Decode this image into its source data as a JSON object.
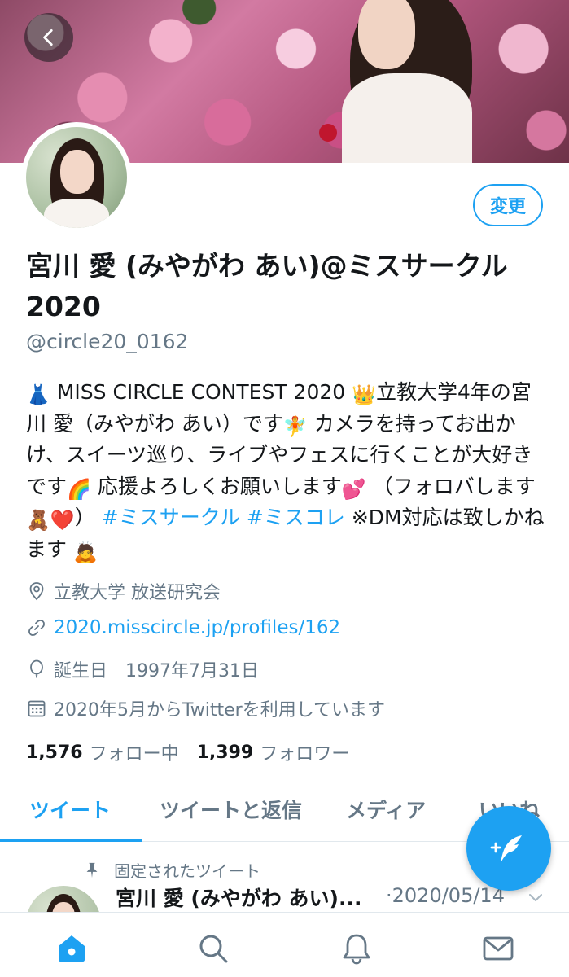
{
  "profile": {
    "edit_label": "変更",
    "display_name": "宮川 愛 (みやがわ あい)@ミスサークル2020",
    "handle": "@circle20_0162",
    "bio": {
      "part1": "MISS CIRCLE CONTEST 2020",
      "part2": "立教大学4年の宮川 愛（みやがわ あい）です",
      "part3": "カメラを持ってお出かけ、スイーツ巡り、ライブやフェスに行くことが大好きです",
      "part4": "応援よろしくお願いします",
      "part5": "（フォロバします",
      "part6": "）",
      "tag1": "#ミスサークル",
      "tag2": "#ミスコレ",
      "part7": "※DM対応は致しかねます"
    },
    "location": "立教大学 放送研究会",
    "website": "2020.misscircle.jp/profiles/162",
    "birthday_label": "誕生日",
    "birthday": "1997年7月31日",
    "joined": "2020年5月からTwitterを利用しています",
    "following_count": "1,576",
    "following_label": "フォロー中",
    "followers_count": "1,399",
    "followers_label": "フォロワー"
  },
  "tabs": [
    {
      "label": "ツイート",
      "active": true
    },
    {
      "label": "ツイートと返信",
      "active": false
    },
    {
      "label": "メディア",
      "active": false
    },
    {
      "label": "いいね",
      "active": false
    }
  ],
  "pinned_tweet": {
    "pinned_label": "固定されたツイート",
    "author_name": "宮川 愛 (みやがわ あい)...",
    "date": "·2020/05/14"
  },
  "bottom_nav": [
    {
      "icon": "home-icon",
      "active": true
    },
    {
      "icon": "search-icon",
      "active": false
    },
    {
      "icon": "bell-icon",
      "active": false
    },
    {
      "icon": "mail-icon",
      "active": false
    }
  ],
  "colors": {
    "accent": "#1da1f2",
    "text_primary": "#14171a",
    "text_secondary": "#657786",
    "divider": "#e1e8ed"
  }
}
